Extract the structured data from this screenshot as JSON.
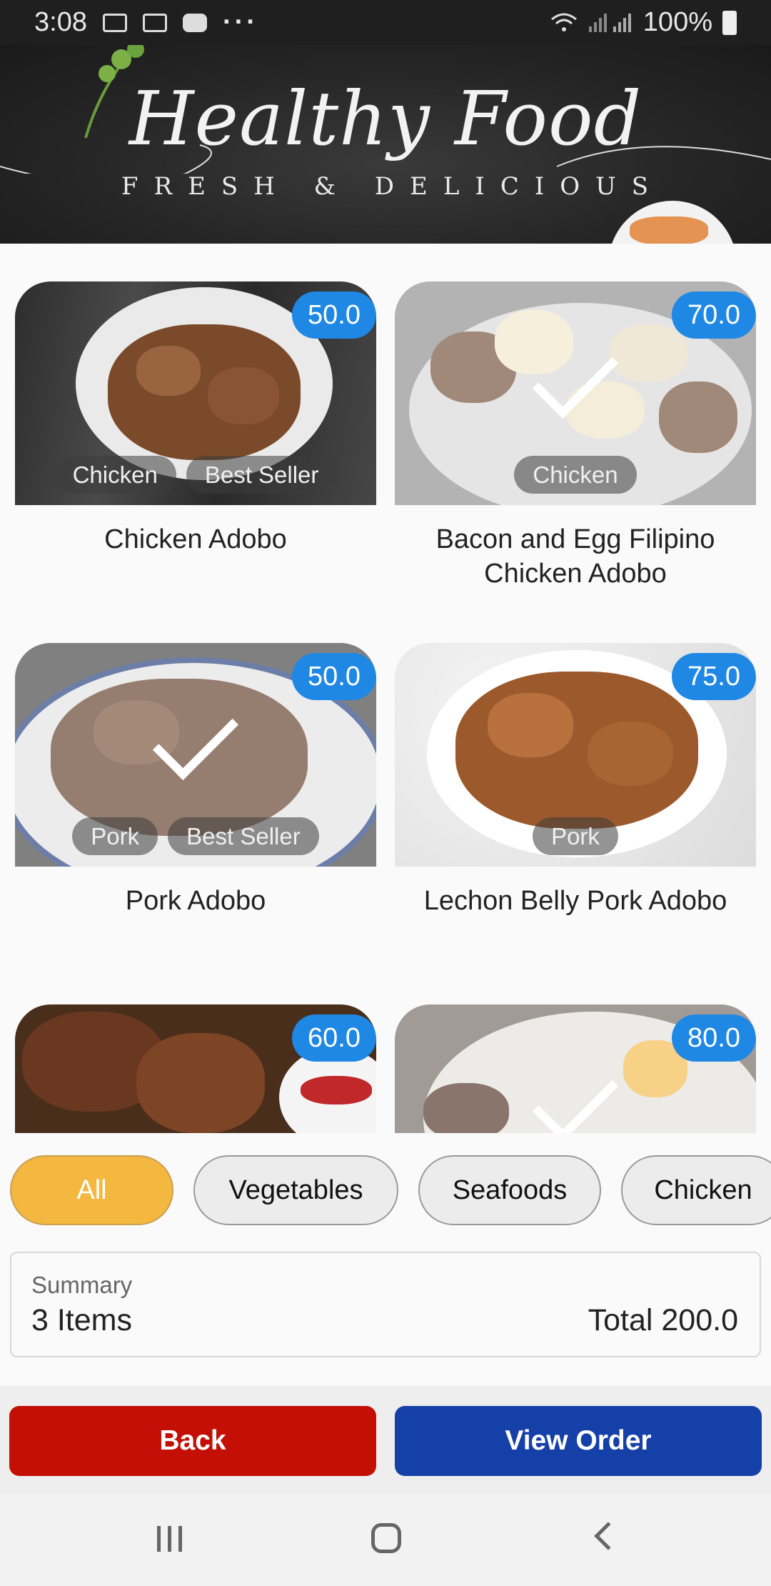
{
  "status_bar": {
    "time": "3:08",
    "more": "···",
    "battery": "100%"
  },
  "banner": {
    "title": "Healthy Food",
    "subtitle": "FRESH & DELICIOUS"
  },
  "products": [
    {
      "name": "Chicken Adobo",
      "price": "50.0",
      "tags": [
        "Chicken",
        "Best Seller"
      ],
      "selected": false
    },
    {
      "name": "Bacon and Egg Filipino Chicken Adobo",
      "price": "70.0",
      "tags": [
        "Chicken"
      ],
      "selected": true
    },
    {
      "name": "Pork Adobo",
      "price": "50.0",
      "tags": [
        "Pork",
        "Best Seller"
      ],
      "selected": true
    },
    {
      "name": "Lechon Belly Pork Adobo",
      "price": "75.0",
      "tags": [
        "Pork"
      ],
      "selected": false
    },
    {
      "name": "",
      "price": "60.0",
      "tags": [],
      "selected": false
    },
    {
      "name": "",
      "price": "80.0",
      "tags": [],
      "selected": true
    }
  ],
  "categories": [
    {
      "label": "All",
      "active": true
    },
    {
      "label": "Vegetables",
      "active": false
    },
    {
      "label": "Seafoods",
      "active": false
    },
    {
      "label": "Chicken",
      "active": false
    }
  ],
  "summary": {
    "label": "Summary",
    "items": "3 Items",
    "total": "Total 200.0"
  },
  "actions": {
    "back": "Back",
    "view_order": "View Order"
  },
  "colors": {
    "price_badge": "#1f88e5",
    "active_chip": "#f4b740",
    "back_button": "#c30f05",
    "order_button": "#1540a8"
  }
}
